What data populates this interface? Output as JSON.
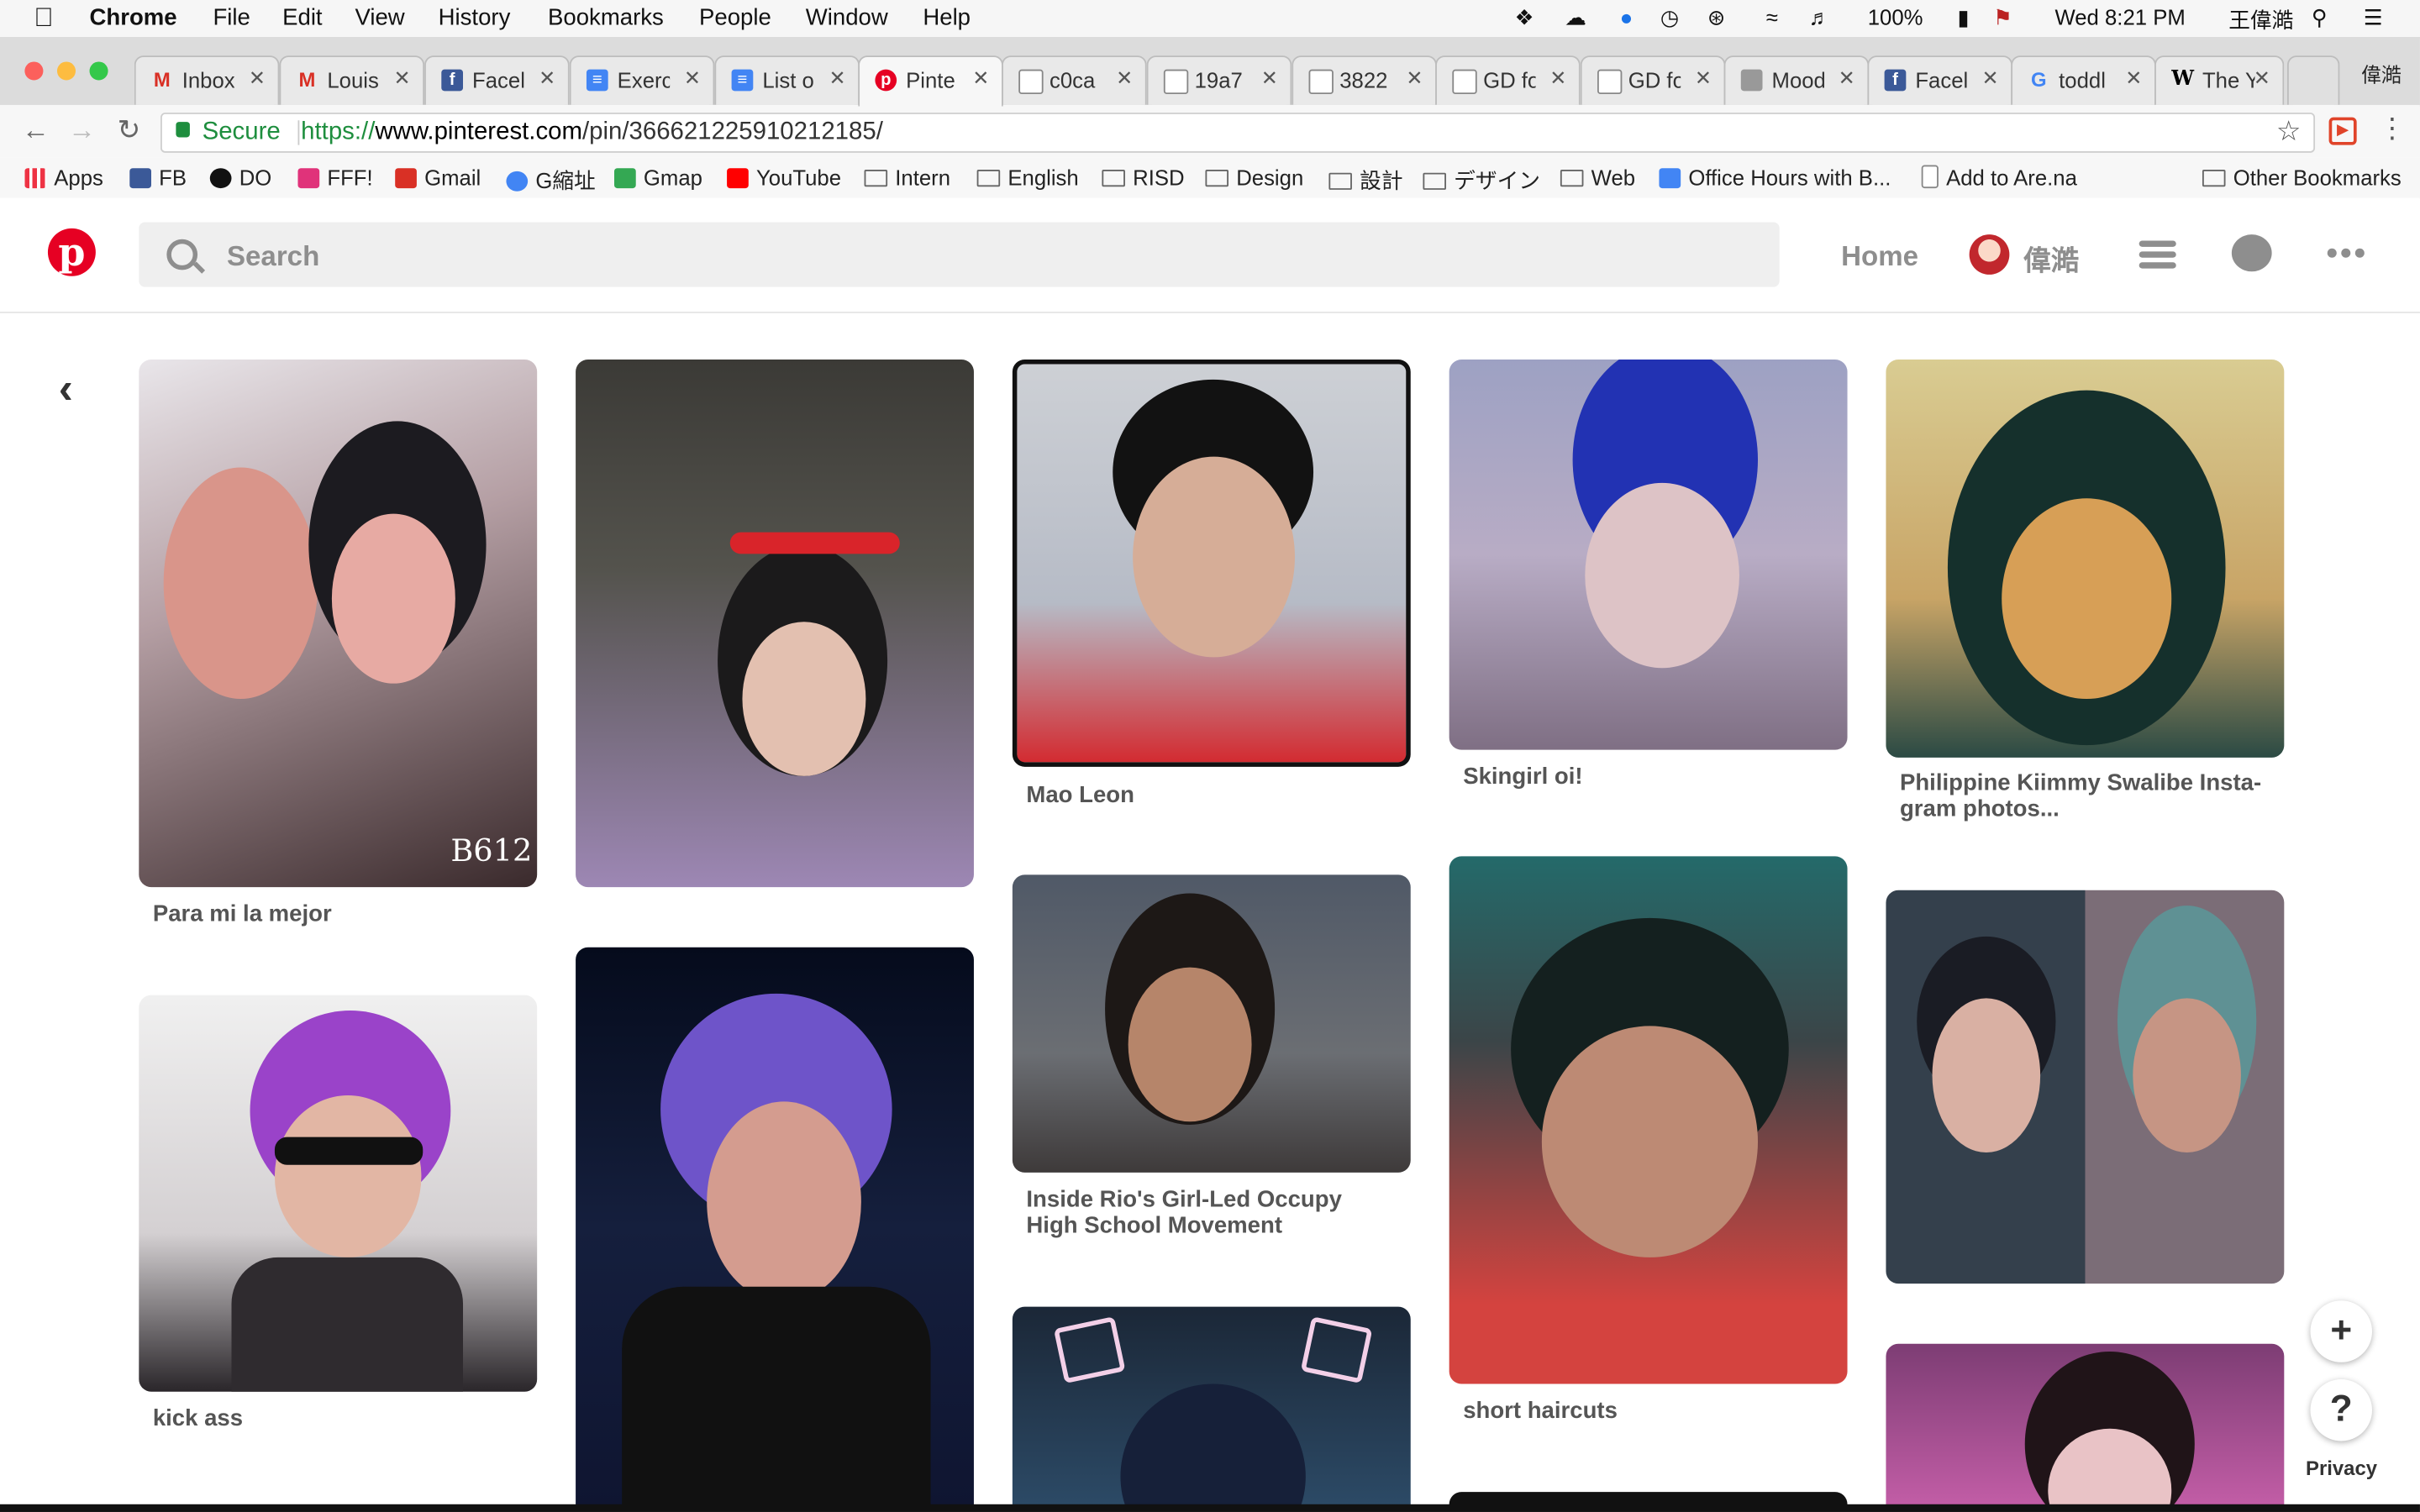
{
  "menubar": {
    "app_name": "Chrome",
    "menus": [
      "File",
      "Edit",
      "View",
      "History",
      "Bookmarks",
      "People",
      "Window",
      "Help"
    ],
    "battery": "100%",
    "clock": "Wed 8:21 PM",
    "user": "王偉澔"
  },
  "tabs": [
    {
      "label": "Inbox",
      "favicon": "gmail-icon"
    },
    {
      "label": "Louis",
      "favicon": "gmail-icon"
    },
    {
      "label": "Facel",
      "favicon": "facebook-icon"
    },
    {
      "label": "Exerc",
      "favicon": "docs-icon"
    },
    {
      "label": "List o",
      "favicon": "docs-icon"
    },
    {
      "label": "Pinte",
      "favicon": "pinterest-icon",
      "active": true
    },
    {
      "label": "c0ca",
      "favicon": "page-icon"
    },
    {
      "label": "19a7",
      "favicon": "page-icon"
    },
    {
      "label": "3822",
      "favicon": "page-icon"
    },
    {
      "label": "GD fo",
      "favicon": "page-icon"
    },
    {
      "label": "GD fo",
      "favicon": "page-icon"
    },
    {
      "label": "Mood",
      "favicon": "page-icon"
    },
    {
      "label": "Facel",
      "favicon": "facebook-icon"
    },
    {
      "label": "toddl",
      "favicon": "google-icon"
    },
    {
      "label": "The Y",
      "favicon": "wikipedia-icon"
    }
  ],
  "tab_user": "偉澔",
  "address": {
    "secure_label": "Secure",
    "protocol": "https://",
    "host": "www.pinterest.com",
    "path": "/pin/366621225910212185/"
  },
  "bookmarks": [
    {
      "label": "Apps"
    },
    {
      "label": "FB"
    },
    {
      "label": "DO"
    },
    {
      "label": "FFF!"
    },
    {
      "label": "Gmail"
    },
    {
      "label": "G縮址"
    },
    {
      "label": "Gmap"
    },
    {
      "label": "YouTube"
    },
    {
      "label": "Intern"
    },
    {
      "label": "English"
    },
    {
      "label": "RISD"
    },
    {
      "label": "Design"
    },
    {
      "label": "設計"
    },
    {
      "label": "デザイン"
    },
    {
      "label": "Web"
    },
    {
      "label": "Office Hours with B..."
    },
    {
      "label": "Add to Are.na"
    }
  ],
  "other_bookmarks": "Other Bookmarks",
  "pinterest": {
    "search_placeholder": "Search",
    "home_label": "Home",
    "user_name": "偉澔"
  },
  "pins": [
    {
      "title": "Para mi la mejor",
      "watermark": "B612"
    },
    {
      "title": ""
    },
    {
      "title": "Mao Leon"
    },
    {
      "title": "Skingirl oi!"
    },
    {
      "title": "Philippine Kiimmy Swalibe Insta- gram photos..."
    },
    {
      "title": "kick ass"
    },
    {
      "title": ""
    },
    {
      "title": "Inside Rio's Girl-Led Occupy High School Movement"
    },
    {
      "title": ""
    },
    {
      "title": "short haircuts"
    },
    {
      "title": ""
    },
    {
      "title": ""
    }
  ],
  "fab": {
    "plus": "+",
    "help": "?",
    "privacy": "Privacy"
  }
}
